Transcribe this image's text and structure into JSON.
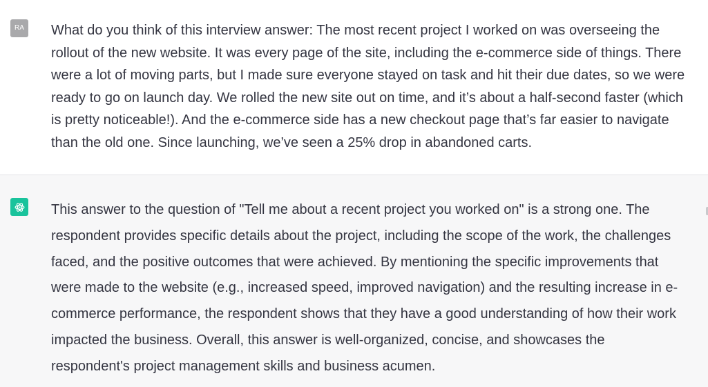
{
  "user_message": {
    "avatar_initials": "RA",
    "text": "What do you think of this interview answer: The most recent project I worked on was overseeing the rollout of the new website. It was every page of the site, including the e-commerce side of things. There were a lot of moving parts, but I made sure everyone stayed on task and hit their due dates, so we were ready to go on launch day. We rolled the new site out on time, and it’s about a half-second faster (which is pretty noticeable!). And the e-commerce side has a new checkout page that’s far easier to navigate than the old one. Since launching, we’ve seen a 25% drop in abandoned carts."
  },
  "assistant_message": {
    "avatar_icon": "openai-logo-icon",
    "text": "This answer to the question of \"Tell me about a recent project you worked on\" is a strong one. The respondent provides specific details about the project, including the scope of the work, the challenges faced, and the positive outcomes that were achieved. By mentioning the specific improvements that were made to the website (e.g., increased speed, improved navigation) and the resulting increase in e-commerce performance, the respondent shows that they have a good understanding of how their work impacted the business. Overall, this answer is well-organized, concise, and showcases the respondent's project management skills and business acumen."
  },
  "colors": {
    "user_background": "#ffffff",
    "assistant_background": "#f7f7f8",
    "text": "#343541",
    "user_avatar": "#a9a9ab",
    "assistant_avatar": "#19c39c"
  }
}
